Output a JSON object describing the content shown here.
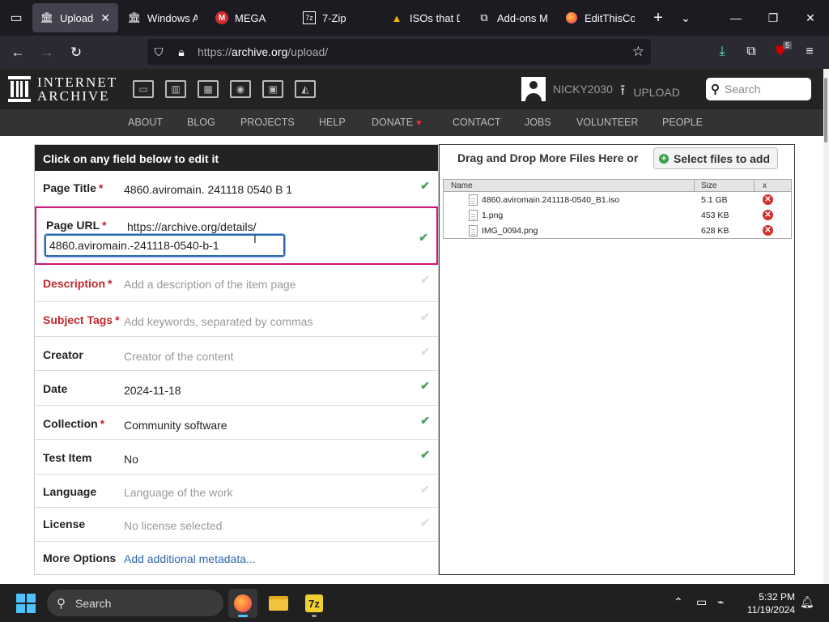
{
  "browser": {
    "tabs": [
      {
        "label": "Upload",
        "icon": "archive-icon",
        "active": true
      },
      {
        "label": "Windows A",
        "icon": "archive-icon"
      },
      {
        "label": "MEGA",
        "icon": "mega-icon"
      },
      {
        "label": "7-Zip",
        "icon": "7zip-icon"
      },
      {
        "label": "ISOs that D",
        "icon": "drive-icon"
      },
      {
        "label": "Add-ons M",
        "icon": "puzzle-icon"
      },
      {
        "label": "EditThisCo",
        "icon": "firefox-icon"
      }
    ],
    "url_prefix": "https://",
    "url_host": "archive.org",
    "url_path": "/upload/",
    "extension_badge": "5"
  },
  "ia_header": {
    "logo_line1": "INTERNET",
    "logo_line2": "ARCHIVE",
    "username": "NICKY2030",
    "upload_label": "UPLOAD",
    "search_placeholder": "Search"
  },
  "topnav": [
    "ABOUT",
    "BLOG",
    "PROJECTS",
    "HELP",
    "DONATE",
    "CONTACT",
    "JOBS",
    "VOLUNTEER",
    "PEOPLE"
  ],
  "form": {
    "header": "Click on any field below to edit it",
    "page_title_label": "Page Title",
    "page_title_value": "4860.aviromain. 241118 0540 B 1",
    "page_url_label": "Page URL",
    "page_url_prefix": "https://archive.org/details/",
    "page_url_value": "4860.aviromain.-241118-0540-b-1",
    "description_label": "Description",
    "description_placeholder": "Add a description of the item page",
    "subject_label": "Subject Tags",
    "subject_placeholder": "Add keywords, separated by commas",
    "creator_label": "Creator",
    "creator_placeholder": "Creator of the content",
    "date_label": "Date",
    "date_value": "2024-11-18",
    "collection_label": "Collection",
    "collection_value": "Community software",
    "test_item_label": "Test Item",
    "test_item_value": "No",
    "language_label": "Language",
    "language_placeholder": "Language of the work",
    "license_label": "License",
    "license_value": "No license selected",
    "more_options_label": "More Options",
    "more_options_link": "Add additional metadata..."
  },
  "files": {
    "drop_text": "Drag and Drop More Files Here or",
    "select_button": "Select files to add",
    "col_name": "Name",
    "col_size": "Size",
    "col_x": "x",
    "rows": [
      {
        "name": "4860.aviromain.241118-0540_B1.iso",
        "size": "5.1 GB"
      },
      {
        "name": "1.png",
        "size": "453 KB"
      },
      {
        "name": "IMG_0094.png",
        "size": "628 KB"
      }
    ]
  },
  "taskbar": {
    "search_label": "Search",
    "time": "5:32 PM",
    "date": "11/19/2024"
  }
}
